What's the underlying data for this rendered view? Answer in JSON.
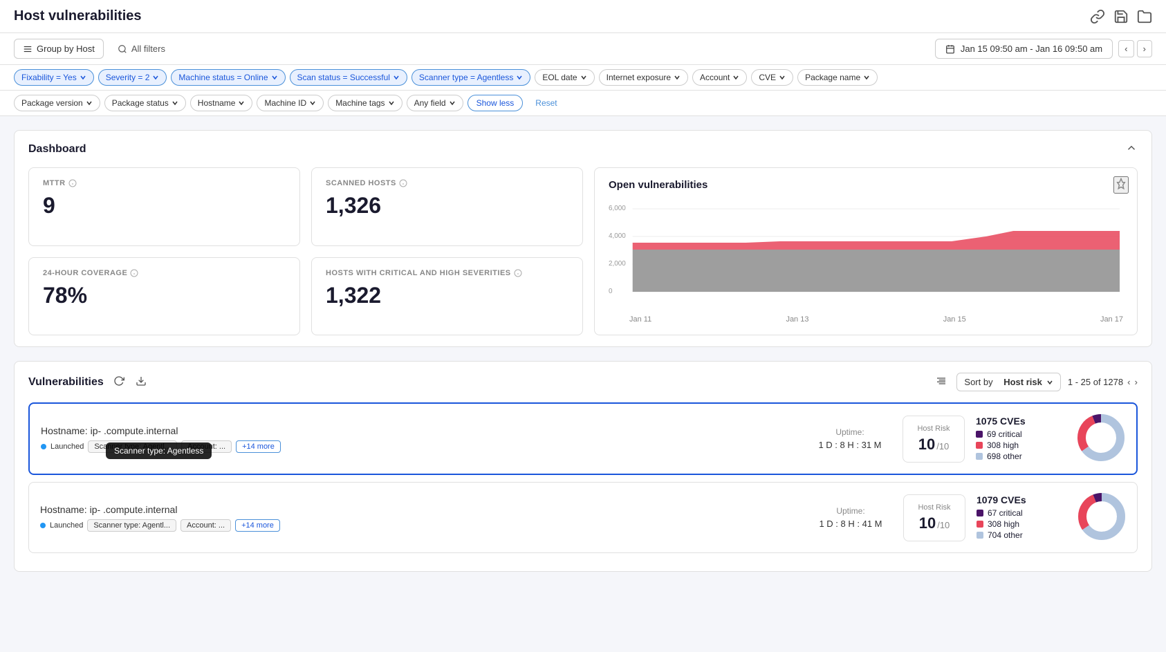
{
  "page": {
    "title": "Host vulnerabilities"
  },
  "toolbar": {
    "group_by_label": "Group by Host",
    "all_filters_label": "All filters",
    "date_range": "Jan 15 09:50 am - Jan 16 09:50 am"
  },
  "filters": {
    "row1": [
      {
        "id": "fixability",
        "label": "Fixability = Yes",
        "active": true
      },
      {
        "id": "severity",
        "label": "Severity = 2",
        "active": true
      },
      {
        "id": "machine_status",
        "label": "Machine status = Online",
        "active": true
      },
      {
        "id": "scan_status",
        "label": "Scan status = Successful",
        "active": true
      },
      {
        "id": "scanner_type",
        "label": "Scanner type = Agentless",
        "active": true
      },
      {
        "id": "eol_date",
        "label": "EOL date",
        "active": false
      },
      {
        "id": "internet_exposure",
        "label": "Internet exposure",
        "active": false
      },
      {
        "id": "account",
        "label": "Account",
        "active": false
      },
      {
        "id": "cve",
        "label": "CVE",
        "active": false
      },
      {
        "id": "package_name",
        "label": "Package name",
        "active": false
      }
    ],
    "row2": [
      {
        "id": "package_version",
        "label": "Package version",
        "active": false
      },
      {
        "id": "package_status",
        "label": "Package status",
        "active": false
      },
      {
        "id": "hostname",
        "label": "Hostname",
        "active": false
      },
      {
        "id": "machine_id",
        "label": "Machine ID",
        "active": false
      },
      {
        "id": "machine_tags",
        "label": "Machine tags",
        "active": false
      },
      {
        "id": "any_field",
        "label": "Any field",
        "active": false
      }
    ],
    "show_less_label": "Show less",
    "reset_label": "Reset"
  },
  "dashboard": {
    "title": "Dashboard",
    "metrics": {
      "mttr": {
        "label": "MTTR",
        "value": "9"
      },
      "scanned_hosts": {
        "label": "SCANNED HOSTS",
        "value": "1,326"
      },
      "coverage": {
        "label": "24-HOUR COVERAGE",
        "value": "78%"
      },
      "critical_high": {
        "label": "HOSTS WITH CRITICAL AND HIGH SEVERITIES",
        "value": "1,322"
      }
    },
    "chart": {
      "title": "Open vulnerabilities",
      "y_labels": [
        "6,000",
        "4,000",
        "2,000",
        "0"
      ],
      "x_labels": [
        "Jan 11",
        "Jan 13",
        "Jan 15",
        "Jan 17"
      ]
    }
  },
  "vulnerabilities": {
    "title": "Vulnerabilities",
    "sort_label": "Sort by",
    "sort_value": "Host risk",
    "pagination": "1 - 25 of 1278",
    "rows": [
      {
        "hostname_prefix": "Hostname: ip-",
        "hostname_domain": ".compute.internal",
        "status": "Launched",
        "scanner": "Scanner type: Agentl...",
        "account": "Account:",
        "account_val": "...",
        "more": "+14 more",
        "uptime_label": "Uptime:",
        "uptime_value": "1 D : 8 H : 31 M",
        "host_risk_label": "Host Risk",
        "host_risk_value": "10",
        "host_risk_denom": "/10",
        "cve_count": "1075 CVEs",
        "cve_critical": "69 critical",
        "cve_high": "308 high",
        "cve_other": "698 other",
        "donut": {
          "critical": 6.4,
          "high": 28.6,
          "other": 65
        }
      },
      {
        "hostname_prefix": "Hostname: ip-",
        "hostname_domain": ".compute.internal",
        "status": "Launched",
        "scanner": "Scanner type: Agentl...",
        "account": "Account:",
        "account_val": "...",
        "more": "+14 more",
        "uptime_label": "Uptime:",
        "uptime_value": "1 D : 8 H : 41 M",
        "host_risk_label": "Host Risk",
        "host_risk_value": "10",
        "host_risk_denom": "/10",
        "cve_count": "1079 CVEs",
        "cve_critical": "67 critical",
        "cve_high": "308 high",
        "cve_other": "704 other",
        "donut": {
          "critical": 6.2,
          "high": 28.5,
          "other": 65.3
        }
      }
    ],
    "tooltip": "Scanner type: Agentless"
  }
}
